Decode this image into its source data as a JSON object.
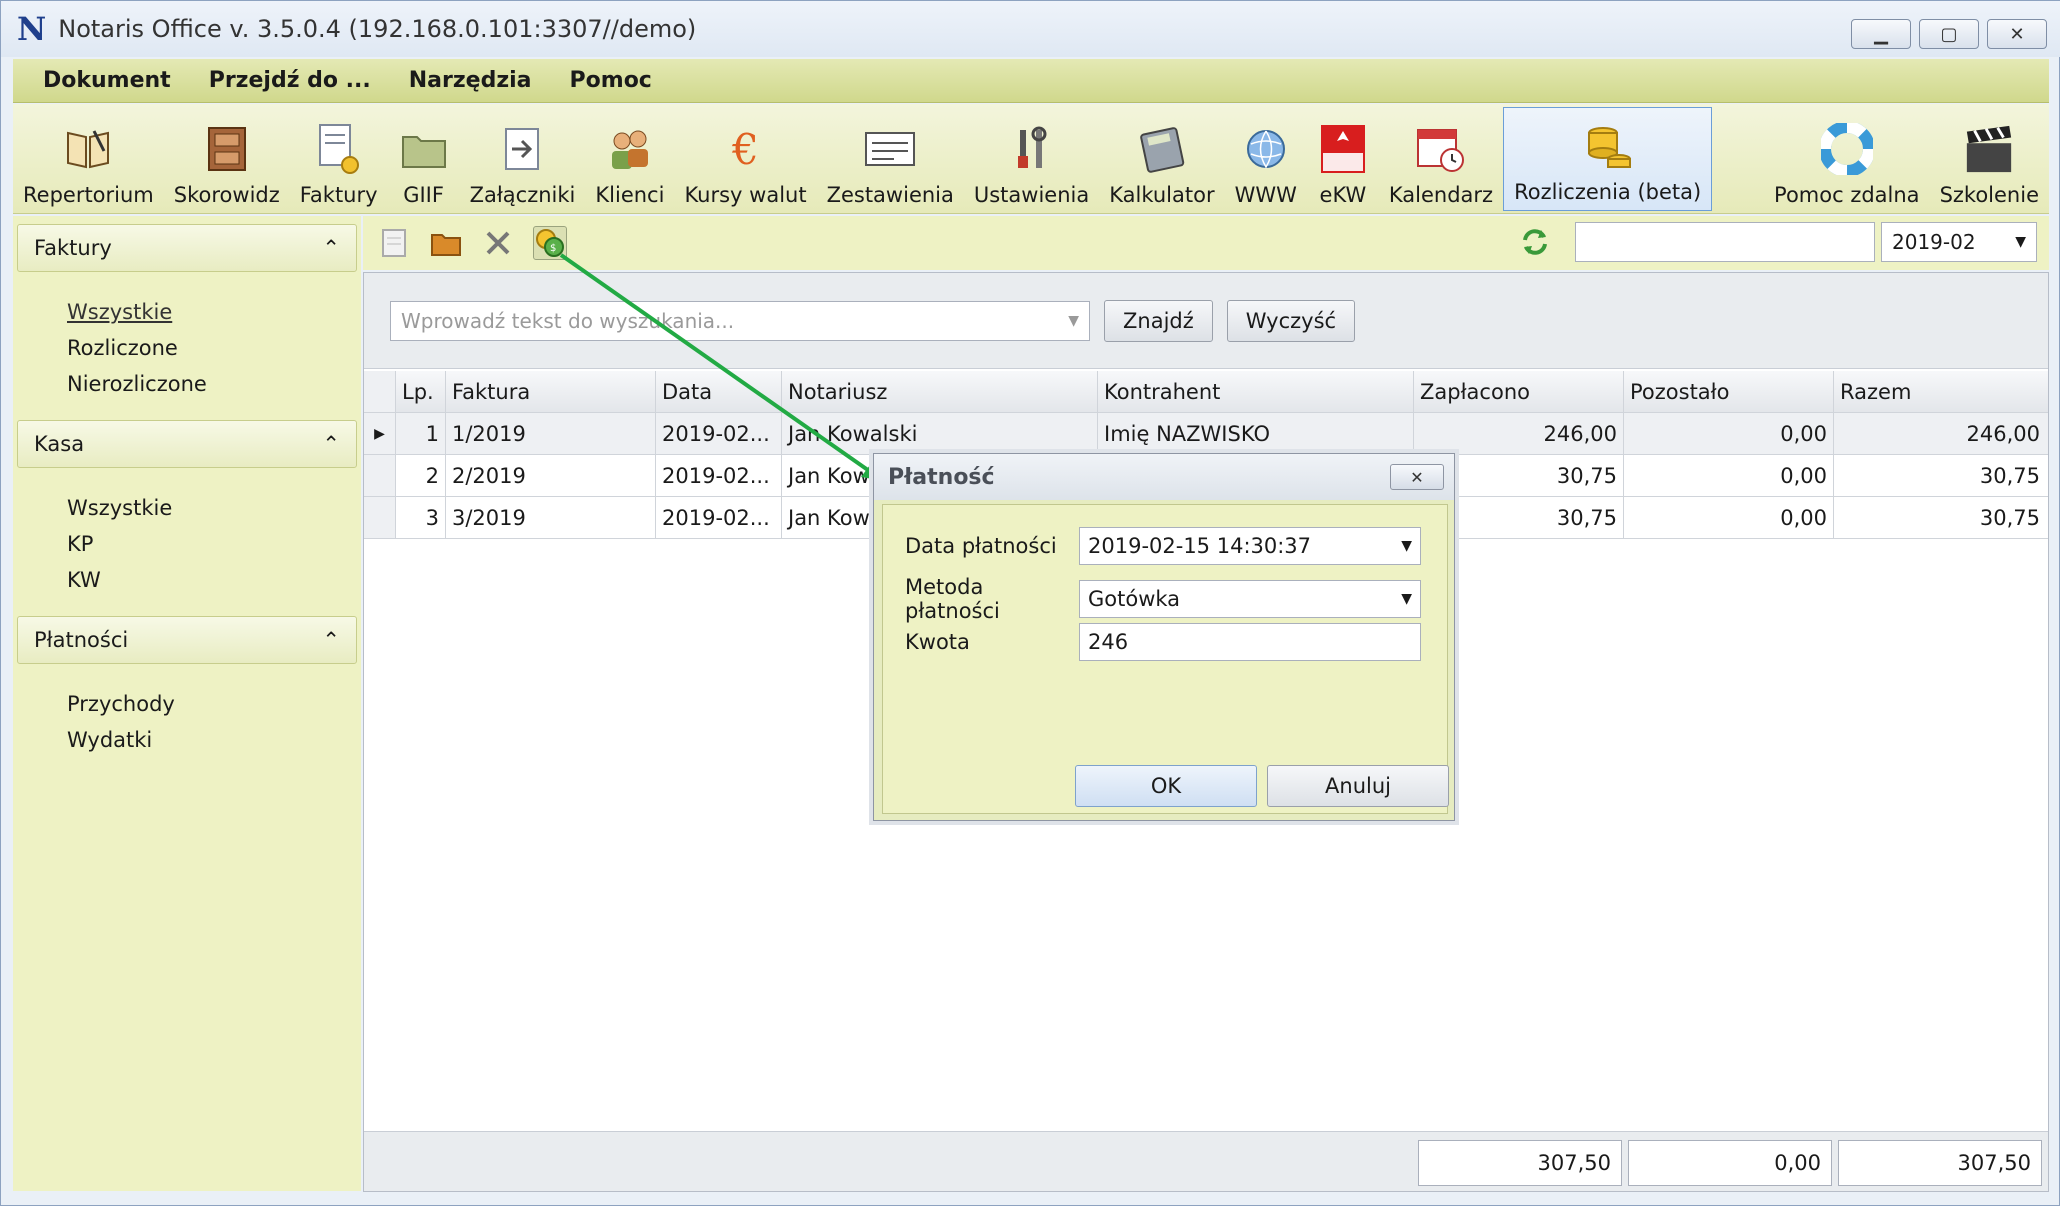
{
  "window": {
    "logo": "N",
    "title": "Notaris Office v. 3.5.0.4 (192.168.0.101:3307//demo)",
    "controls": [
      "minimize",
      "maximize",
      "close"
    ]
  },
  "menu": [
    "Dokument",
    "Przejdź do ...",
    "Narzędzia",
    "Pomoc"
  ],
  "ribbon": {
    "tools": [
      {
        "label": "Repertorium",
        "icon": "book-icon"
      },
      {
        "label": "Skorowidz",
        "icon": "cabinet-icon"
      },
      {
        "label": "Faktury",
        "icon": "invoice-icon"
      },
      {
        "label": "GIIF",
        "icon": "folder-icon"
      },
      {
        "label": "Załączniki",
        "icon": "attachment-icon"
      },
      {
        "label": "Klienci",
        "icon": "clients-icon"
      },
      {
        "label": "Kursy walut",
        "icon": "euro-icon"
      },
      {
        "label": "Zestawienia",
        "icon": "report-icon"
      },
      {
        "label": "Ustawienia",
        "icon": "tools-icon"
      },
      {
        "label": "Kalkulator",
        "icon": "calculator-icon"
      },
      {
        "label": "WWW",
        "icon": "globe-icon"
      },
      {
        "label": "eKW",
        "icon": "ekw-icon"
      },
      {
        "label": "Kalendarz",
        "icon": "calendar-icon"
      },
      {
        "label": "Rozliczenia (beta)",
        "icon": "coins-icon",
        "active": true
      }
    ],
    "right_tools": [
      {
        "label": "Pomoc zdalna",
        "icon": "lifebuoy-icon"
      },
      {
        "label": "Szkolenie",
        "icon": "clapperboard-icon"
      }
    ]
  },
  "sidebar": {
    "sections": [
      {
        "title": "Faktury",
        "items": [
          {
            "label": "Wszystkie",
            "selected": true
          },
          {
            "label": "Rozliczone"
          },
          {
            "label": "Nierozliczone"
          }
        ]
      },
      {
        "title": "Kasa",
        "items": [
          {
            "label": "Wszystkie"
          },
          {
            "label": "KP"
          },
          {
            "label": "KW"
          }
        ]
      },
      {
        "title": "Płatności",
        "items": [
          {
            "label": "Przychody"
          },
          {
            "label": "Wydatki"
          }
        ]
      }
    ]
  },
  "subtoolbar": {
    "period_value": "2019-02",
    "filter_value": ""
  },
  "search": {
    "placeholder": "Wprowadź tekst do wyszukania...",
    "find_label": "Znajdź",
    "clear_label": "Wyczyść"
  },
  "grid": {
    "columns": [
      "Lp.",
      "Faktura",
      "Data",
      "Notariusz",
      "Kontrahent",
      "Zapłacono",
      "Pozostało",
      "Razem"
    ],
    "rows": [
      {
        "lp": "1",
        "faktura": "1/2019",
        "data": "2019-02...",
        "notariusz": "Jan Kowalski",
        "kontrahent": "Imię NAZWISKO",
        "zaplacono": "246,00",
        "pozostalo": "0,00",
        "razem": "246,00"
      },
      {
        "lp": "2",
        "faktura": "2/2019",
        "data": "2019-02...",
        "notariusz": "Jan Kow",
        "kontrahent": "",
        "zaplacono": "30,75",
        "pozostalo": "0,00",
        "razem": "30,75"
      },
      {
        "lp": "3",
        "faktura": "3/2019",
        "data": "2019-02...",
        "notariusz": "Jan Kow",
        "kontrahent": "",
        "zaplacono": "30,75",
        "pozostalo": "0,00",
        "razem": "30,75"
      }
    ],
    "totals": {
      "zaplacono": "307,50",
      "pozostalo": "0,00",
      "razem": "307,50"
    }
  },
  "dialog": {
    "title": "Płatność",
    "fields": {
      "date_label": "Data płatności",
      "date_value": "2019-02-15 14:30:37",
      "method_label": "Metoda płatności",
      "method_value": "Gotówka",
      "amount_label": "Kwota",
      "amount_value": "246"
    },
    "ok_label": "OK",
    "cancel_label": "Anuluj"
  },
  "colors": {
    "ribbon_bg": "#e6eab9",
    "sidebar_bg": "#eef2c4",
    "annotation_arrow": "#22aa44",
    "active_border": "#6b9ed8"
  }
}
